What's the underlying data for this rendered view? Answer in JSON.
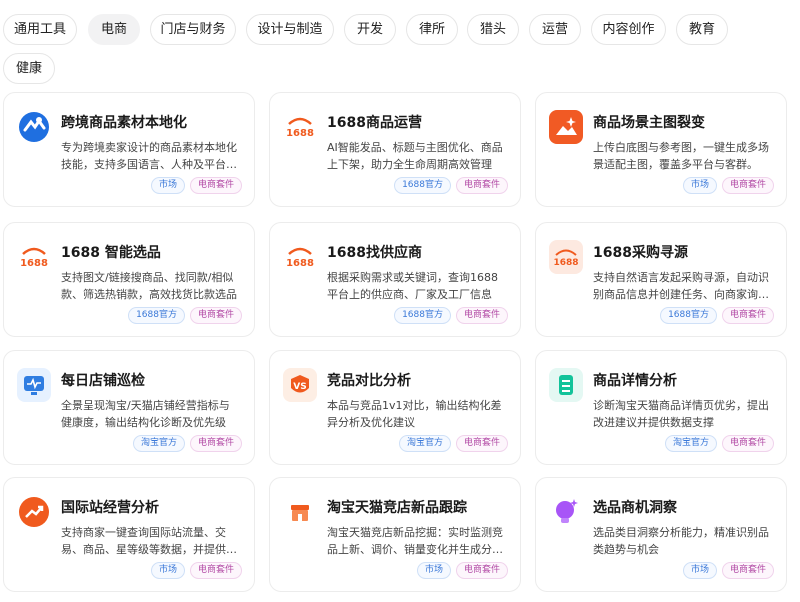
{
  "filters": [
    {
      "label": "通用工具",
      "active": false
    },
    {
      "label": "电商",
      "active": true
    },
    {
      "label": "门店与财务",
      "active": false
    },
    {
      "label": "设计与制造",
      "active": false
    },
    {
      "label": "开发",
      "active": false
    },
    {
      "label": "律所",
      "active": false
    },
    {
      "label": "猎头",
      "active": false
    },
    {
      "label": "运营",
      "active": false
    },
    {
      "label": "内容创作",
      "active": false
    },
    {
      "label": "教育",
      "active": false
    },
    {
      "label": "健康",
      "active": false
    }
  ],
  "cards": [
    {
      "title": "跨境商品素材本地化",
      "desc": "专为跨境卖家设计的商品素材本地化技能，支持多国语言、人种及平台…",
      "icon": "map-globe-icon",
      "tags": [
        "市场",
        "电商套件"
      ]
    },
    {
      "title": "1688商品运营",
      "desc": "AI智能发品、标题与主图优化、商品上下架，助力全生命周期高效管理",
      "icon": "1688-logo-icon",
      "tags": [
        "1688官方",
        "电商套件"
      ]
    },
    {
      "title": "商品场景主图裂变",
      "desc": "上传白底图与参考图，一键生成多场景适配主图，覆盖多平台与客群。",
      "icon": "image-sparkle-icon",
      "tags": [
        "市场",
        "电商套件"
      ]
    },
    {
      "title": "1688 智能选品",
      "desc": "支持图文/链接搜商品、找同款/相似款、筛选热销款，高效找货比款选品",
      "icon": "1688-logo-icon",
      "tags": [
        "1688官方",
        "电商套件"
      ]
    },
    {
      "title": "1688找供应商",
      "desc": "根据采购需求或关键词，查询1688平台上的供应商、厂家及工厂信息",
      "icon": "1688-logo-icon",
      "tags": [
        "1688官方",
        "电商套件"
      ]
    },
    {
      "title": "1688采购寻源",
      "desc": "支持自然语言发起采购寻源，自动识别商品信息并创建任务、向商家询…",
      "icon": "1688-logo-icon",
      "tags": [
        "1688官方",
        "电商套件"
      ]
    },
    {
      "title": "每日店铺巡检",
      "desc": "全景呈现淘宝/天猫店铺经营指标与健康度，输出结构化诊断及优先级建…",
      "icon": "monitor-pulse-icon",
      "tags": [
        "淘宝官方",
        "电商套件"
      ]
    },
    {
      "title": "竞品对比分析",
      "desc": "本品与竞品1v1对比，输出结构化差异分析及优化建议",
      "icon": "versus-icon",
      "tags": [
        "淘宝官方",
        "电商套件"
      ]
    },
    {
      "title": "商品详情分析",
      "desc": "诊断淘宝天猫商品详情页优劣，提出改进建议并提供数据支撑",
      "icon": "clipboard-list-icon",
      "tags": [
        "淘宝官方",
        "电商套件"
      ]
    },
    {
      "title": "国际站经营分析",
      "desc": "支持商家一键查询国际站流量、交易、商品、星等级等数据，并提供…",
      "icon": "trend-up-icon",
      "tags": [
        "市场",
        "电商套件"
      ]
    },
    {
      "title": "淘宝天猫竞店新品跟踪",
      "desc": "淘宝天猫竞店新品挖掘：实时监测竞品上新、调价、销量变化并生成分…",
      "icon": "storefront-icon",
      "tags": [
        "市场",
        "电商套件"
      ]
    },
    {
      "title": "选品商机洞察",
      "desc": "选品类目洞察分析能力，精准识别品类趋势与机会",
      "icon": "lightbulb-sparkle-icon",
      "tags": [
        "市场",
        "电商套件"
      ]
    }
  ],
  "logo_text": "1688",
  "vs_text": "VS",
  "colors": {
    "accent_orange": "#f05a1e",
    "tag_blue": "#3a78d8",
    "tag_pink": "#b24aa5",
    "chip_active_bg": "#f2f2f3"
  }
}
